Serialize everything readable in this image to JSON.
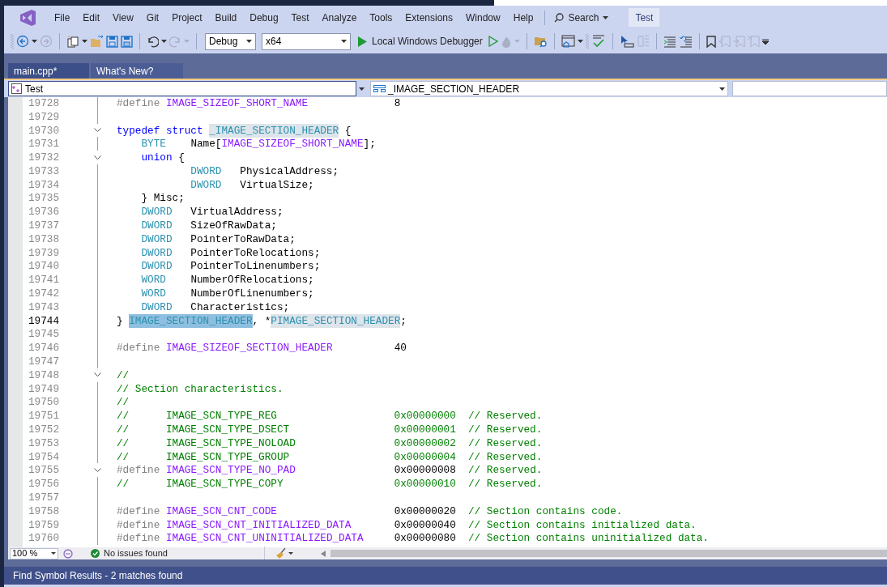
{
  "menu": {
    "items": [
      "File",
      "Edit",
      "View",
      "Git",
      "Project",
      "Build",
      "Debug",
      "Test",
      "Analyze",
      "Tools",
      "Extensions",
      "Window",
      "Help"
    ],
    "search": "Search",
    "solution": "Test"
  },
  "toolbar": {
    "items": [
      {
        "kind": "gripper"
      },
      {
        "kind": "back",
        "disabled": false
      },
      {
        "kind": "caret",
        "disabled": false
      },
      {
        "kind": "forward",
        "disabled": true
      },
      {
        "kind": "separator"
      },
      {
        "kind": "new-project"
      },
      {
        "kind": "caret",
        "disabled": false
      },
      {
        "kind": "open"
      },
      {
        "kind": "save"
      },
      {
        "kind": "save-all"
      },
      {
        "kind": "separator"
      },
      {
        "kind": "undo",
        "disabled": false
      },
      {
        "kind": "caret",
        "disabled": false
      },
      {
        "kind": "redo",
        "disabled": true
      },
      {
        "kind": "caret",
        "disabled": true
      },
      {
        "kind": "separator"
      },
      {
        "kind": "configuration",
        "text": "Debug"
      },
      {
        "kind": "platform",
        "text": "x64"
      },
      {
        "kind": "start",
        "text": "Local Windows Debugger"
      },
      {
        "kind": "start-without-debugging",
        "disabled": false
      },
      {
        "kind": "hot-reload",
        "disabled": true
      },
      {
        "kind": "caret",
        "disabled": true
      },
      {
        "kind": "separator"
      },
      {
        "kind": "find-in-files"
      },
      {
        "kind": "separator"
      },
      {
        "kind": "window"
      },
      {
        "kind": "caret",
        "disabled": false
      },
      {
        "kind": "gripper"
      },
      {
        "kind": "spell-check"
      },
      {
        "kind": "separator"
      },
      {
        "kind": "select"
      },
      {
        "kind": "column",
        "disabled": true
      },
      {
        "kind": "separator"
      },
      {
        "kind": "indent"
      },
      {
        "kind": "outdent"
      },
      {
        "kind": "separator"
      },
      {
        "kind": "bookmark"
      },
      {
        "kind": "bookmark-prev",
        "disabled": true
      },
      {
        "kind": "bookmark-next",
        "disabled": true
      },
      {
        "kind": "bookmark-clear",
        "disabled": true
      },
      {
        "kind": "overflow"
      }
    ]
  },
  "tabs": [
    {
      "label": "main.cpp*",
      "selected": true
    },
    {
      "label": "What's New?",
      "selected": false
    }
  ],
  "navigation_bar": {
    "project": "Test",
    "scope": "_IMAGE_SECTION_HEADER"
  },
  "code_lines": [
    {
      "number": "19728",
      "collapsible": false,
      "current": false,
      "tokens": [
        {
          "kind": "preproc",
          "text": "#define "
        },
        {
          "kind": "macro",
          "text": "IMAGE_SIZEOF_SHORT_NAME"
        },
        {
          "kind": "plain",
          "text": "              8"
        }
      ]
    },
    {
      "number": "19729",
      "collapsible": false,
      "current": false
    },
    {
      "number": "19730",
      "collapsible": true,
      "current": false,
      "tokens": [
        {
          "kind": "keyword",
          "text": "typedef struct "
        },
        {
          "kind": "type",
          "text": "_IMAGE_SECTION_HEADER",
          "highlighted": true,
          "selected": false
        },
        {
          "kind": "plain",
          "text": " {"
        }
      ]
    },
    {
      "number": "19731",
      "collapsible": false,
      "current": false,
      "tokens": [
        {
          "kind": "type",
          "text": "    BYTE"
        },
        {
          "kind": "plain",
          "text": "    Name["
        },
        {
          "kind": "macro",
          "text": "IMAGE_SIZEOF_SHORT_NAME"
        },
        {
          "kind": "plain",
          "text": "];"
        }
      ]
    },
    {
      "number": "19732",
      "collapsible": true,
      "current": false,
      "tokens": [
        {
          "kind": "keyword",
          "text": "    union"
        },
        {
          "kind": "plain",
          "text": " {"
        }
      ]
    },
    {
      "number": "19733",
      "collapsible": false,
      "current": false,
      "tokens": [
        {
          "kind": "type",
          "text": "            DWORD"
        },
        {
          "kind": "plain",
          "text": "   PhysicalAddress;"
        }
      ]
    },
    {
      "number": "19734",
      "collapsible": false,
      "current": false,
      "tokens": [
        {
          "kind": "type",
          "text": "            DWORD"
        },
        {
          "kind": "plain",
          "text": "   VirtualSize;"
        }
      ]
    },
    {
      "number": "19735",
      "collapsible": false,
      "current": false,
      "tokens": [
        {
          "kind": "plain",
          "text": "    } Misc;"
        }
      ]
    },
    {
      "number": "19736",
      "collapsible": false,
      "current": false,
      "tokens": [
        {
          "kind": "type",
          "text": "    DWORD"
        },
        {
          "kind": "plain",
          "text": "   VirtualAddress;"
        }
      ]
    },
    {
      "number": "19737",
      "collapsible": false,
      "current": false,
      "tokens": [
        {
          "kind": "type",
          "text": "    DWORD"
        },
        {
          "kind": "plain",
          "text": "   SizeOfRawData;"
        }
      ]
    },
    {
      "number": "19738",
      "collapsible": false,
      "current": false,
      "tokens": [
        {
          "kind": "type",
          "text": "    DWORD"
        },
        {
          "kind": "plain",
          "text": "   PointerToRawData;"
        }
      ]
    },
    {
      "number": "19739",
      "collapsible": false,
      "current": false,
      "tokens": [
        {
          "kind": "type",
          "text": "    DWORD"
        },
        {
          "kind": "plain",
          "text": "   PointerToRelocations;"
        }
      ]
    },
    {
      "number": "19740",
      "collapsible": false,
      "current": false,
      "tokens": [
        {
          "kind": "type",
          "text": "    DWORD"
        },
        {
          "kind": "plain",
          "text": "   PointerToLinenumbers;"
        }
      ]
    },
    {
      "number": "19741",
      "collapsible": false,
      "current": false,
      "tokens": [
        {
          "kind": "type",
          "text": "    WORD"
        },
        {
          "kind": "plain",
          "text": "    NumberOfRelocations;"
        }
      ]
    },
    {
      "number": "19742",
      "collapsible": false,
      "current": false,
      "tokens": [
        {
          "kind": "type",
          "text": "    WORD"
        },
        {
          "kind": "plain",
          "text": "    NumberOfLinenumbers;"
        }
      ]
    },
    {
      "number": "19743",
      "collapsible": false,
      "current": false,
      "tokens": [
        {
          "kind": "type",
          "text": "    DWORD"
        },
        {
          "kind": "plain",
          "text": "   Characteristics;"
        }
      ]
    },
    {
      "number": "19744",
      "collapsible": false,
      "current": true,
      "tokens": [
        {
          "kind": "plain",
          "text": "} "
        },
        {
          "kind": "type",
          "text": "IMAGE_SECTION_HEADER",
          "highlighted": true,
          "selected": true
        },
        {
          "kind": "plain",
          "text": ", *"
        },
        {
          "kind": "type",
          "text": "PIMAGE_SECTION_HEADER",
          "highlighted": true,
          "selected": false
        },
        {
          "kind": "plain",
          "text": ";"
        }
      ]
    },
    {
      "number": "19745",
      "collapsible": false,
      "current": false
    },
    {
      "number": "19746",
      "collapsible": false,
      "current": false,
      "tokens": [
        {
          "kind": "preproc",
          "text": "#define "
        },
        {
          "kind": "macro",
          "text": "IMAGE_SIZEOF_SECTION_HEADER"
        },
        {
          "kind": "plain",
          "text": "          40"
        }
      ]
    },
    {
      "number": "19747",
      "collapsible": false,
      "current": false
    },
    {
      "number": "19748",
      "collapsible": true,
      "current": false,
      "tokens": [
        {
          "kind": "comment",
          "text": "//"
        }
      ]
    },
    {
      "number": "19749",
      "collapsible": false,
      "current": false,
      "tokens": [
        {
          "kind": "comment",
          "text": "// Section characteristics."
        }
      ]
    },
    {
      "number": "19750",
      "collapsible": false,
      "current": false,
      "tokens": [
        {
          "kind": "comment",
          "text": "//"
        }
      ]
    },
    {
      "number": "19751",
      "collapsible": false,
      "current": false,
      "tokens": [
        {
          "kind": "comment",
          "text": "//      IMAGE_SCN_TYPE_REG                   0x00000000  // Reserved."
        }
      ]
    },
    {
      "number": "19752",
      "collapsible": false,
      "current": false,
      "tokens": [
        {
          "kind": "comment",
          "text": "//      IMAGE_SCN_TYPE_DSECT                 0x00000001  // Reserved."
        }
      ]
    },
    {
      "number": "19753",
      "collapsible": false,
      "current": false,
      "tokens": [
        {
          "kind": "comment",
          "text": "//      IMAGE_SCN_TYPE_NOLOAD                0x00000002  // Reserved."
        }
      ]
    },
    {
      "number": "19754",
      "collapsible": false,
      "current": false,
      "tokens": [
        {
          "kind": "comment",
          "text": "//      IMAGE_SCN_TYPE_GROUP                 0x00000004  // Reserved."
        }
      ]
    },
    {
      "number": "19755",
      "collapsible": true,
      "current": false,
      "tokens": [
        {
          "kind": "preproc",
          "text": "#define "
        },
        {
          "kind": "macro",
          "text": "IMAGE_SCN_TYPE_NO_PAD"
        },
        {
          "kind": "plain",
          "text": "                0x00000008"
        },
        {
          "kind": "comment",
          "text": "  // Reserved."
        }
      ]
    },
    {
      "number": "19756",
      "collapsible": false,
      "current": false,
      "tokens": [
        {
          "kind": "comment",
          "text": "//      IMAGE_SCN_TYPE_COPY                  0x00000010  // Reserved."
        }
      ]
    },
    {
      "number": "19757",
      "collapsible": false,
      "current": false
    },
    {
      "number": "19758",
      "collapsible": false,
      "current": false,
      "tokens": [
        {
          "kind": "preproc",
          "text": "#define "
        },
        {
          "kind": "macro",
          "text": "IMAGE_SCN_CNT_CODE"
        },
        {
          "kind": "plain",
          "text": "                   0x00000020"
        },
        {
          "kind": "comment",
          "text": "  // Section contains code."
        }
      ]
    },
    {
      "number": "19759",
      "collapsible": false,
      "current": false,
      "tokens": [
        {
          "kind": "preproc",
          "text": "#define "
        },
        {
          "kind": "macro",
          "text": "IMAGE_SCN_CNT_INITIALIZED_DATA"
        },
        {
          "kind": "plain",
          "text": "       0x00000040"
        },
        {
          "kind": "comment",
          "text": "  // Section contains initialized data."
        }
      ]
    },
    {
      "number": "19760",
      "collapsible": false,
      "current": false,
      "tokens": [
        {
          "kind": "preproc",
          "text": "#define "
        },
        {
          "kind": "macro",
          "text": "IMAGE_SCN_CNT_UNINITIALIZED_DATA"
        },
        {
          "kind": "plain",
          "text": "     0x00000080"
        },
        {
          "kind": "comment",
          "text": "  // Section contains uninitialized data."
        }
      ]
    }
  ],
  "status_bar": {
    "zoom": "100 %",
    "issues": "No issues found"
  },
  "bottom_panel": {
    "title": "Find Symbol Results - 2 matches found"
  }
}
